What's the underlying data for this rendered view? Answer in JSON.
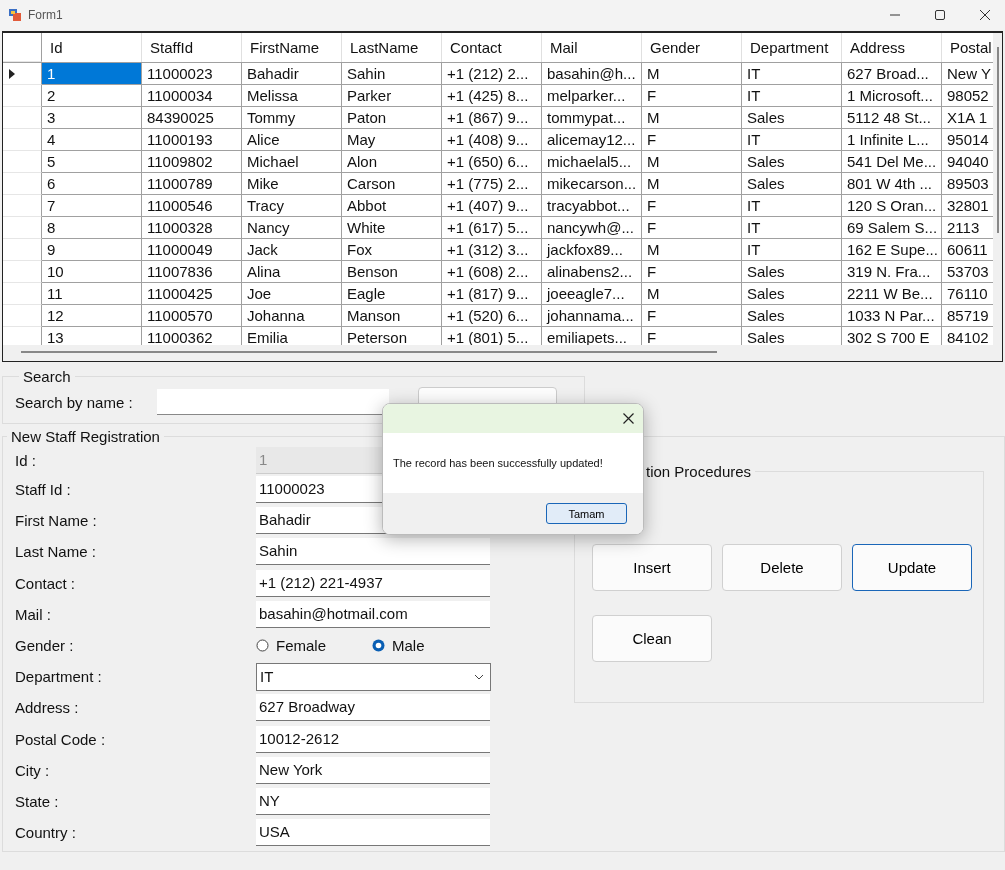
{
  "window": {
    "title": "Form1"
  },
  "grid": {
    "columns": [
      "Id",
      "StaffId",
      "FirstName",
      "LastName",
      "Contact",
      "Mail",
      "Gender",
      "Department",
      "Address",
      "Postal"
    ],
    "rows": [
      {
        "selected": true,
        "cells": [
          "1",
          "11000023",
          "Bahadir",
          "Sahin",
          "+1 (212) 2...",
          "basahin@h...",
          "M",
          "IT",
          "627 Broad...",
          "New Y"
        ]
      },
      {
        "selected": false,
        "cells": [
          "2",
          "11000034",
          "Melissa",
          "Parker",
          "+1 (425) 8...",
          "melparker...",
          "F",
          "IT",
          "1 Microsoft...",
          "98052"
        ]
      },
      {
        "selected": false,
        "cells": [
          "3",
          "84390025",
          "Tommy",
          "Paton",
          "+1 (867) 9...",
          "tommypat...",
          "M",
          "Sales",
          "5112 48 St...",
          "X1A 1"
        ]
      },
      {
        "selected": false,
        "cells": [
          "4",
          "11000193",
          "Alice",
          "May",
          "+1 (408) 9...",
          "alicemay12...",
          "F",
          "IT",
          "1 Infinite L...",
          "95014"
        ]
      },
      {
        "selected": false,
        "cells": [
          "5",
          "11009802",
          "Michael",
          "Alon",
          "+1 (650) 6...",
          "michaelal5...",
          "M",
          "Sales",
          "541 Del Me...",
          "94040"
        ]
      },
      {
        "selected": false,
        "cells": [
          "6",
          "11000789",
          "Mike",
          "Carson",
          "+1 (775) 2...",
          "mikecarson...",
          "M",
          "Sales",
          "801 W 4th ...",
          "89503"
        ]
      },
      {
        "selected": false,
        "cells": [
          "7",
          "11000546",
          "Tracy",
          "Abbot",
          "+1 (407) 9...",
          "tracyabbot...",
          "F",
          "IT",
          "120 S Oran...",
          "32801"
        ]
      },
      {
        "selected": false,
        "cells": [
          "8",
          "11000328",
          "Nancy",
          "White",
          "+1 (617) 5...",
          "nancywh@...",
          "F",
          "IT",
          "69 Salem S...",
          "2113"
        ]
      },
      {
        "selected": false,
        "cells": [
          "9",
          "11000049",
          "Jack",
          "Fox",
          "+1 (312) 3...",
          "jackfox89...",
          "M",
          "IT",
          "162 E Supe...",
          "60611"
        ]
      },
      {
        "selected": false,
        "cells": [
          "10",
          "11007836",
          "Alina",
          "Benson",
          "+1 (608) 2...",
          "alinabens2...",
          "F",
          "Sales",
          "319 N. Fra...",
          "53703"
        ]
      },
      {
        "selected": false,
        "cells": [
          "11",
          "11000425",
          "Joe",
          "Eagle",
          "+1 (817) 9...",
          "joeeagle7...",
          "M",
          "Sales",
          "2211 W Be...",
          "76110"
        ]
      },
      {
        "selected": false,
        "cells": [
          "12",
          "11000570",
          "Johanna",
          "Manson",
          "+1 (520) 6...",
          "johannama...",
          "F",
          "Sales",
          "1033 N Par...",
          "85719"
        ]
      },
      {
        "selected": false,
        "cells": [
          "13",
          "11000362",
          "Emilia",
          "Peterson",
          "+1 (801) 5...",
          "emiliapets...",
          "F",
          "Sales",
          "302 S 700 E",
          "84102"
        ]
      }
    ]
  },
  "search": {
    "title": "Search",
    "label": "Search by name :"
  },
  "registration": {
    "title": "New Staff Registration",
    "fields": [
      {
        "kind": "text",
        "label": "Id :",
        "value": "1",
        "disabled": true
      },
      {
        "kind": "text",
        "label": "Staff Id :",
        "value": "11000023",
        "disabled": false
      },
      {
        "kind": "text",
        "label": "First Name :",
        "value": "Bahadir",
        "disabled": false
      },
      {
        "kind": "text",
        "label": "Last Name :",
        "value": "Sahin",
        "disabled": false
      },
      {
        "kind": "text",
        "label": "Contact :",
        "value": "+1 (212) 221-4937",
        "disabled": false
      },
      {
        "kind": "text",
        "label": "Mail :",
        "value": "basahin@hotmail.com",
        "disabled": false
      },
      {
        "kind": "radio",
        "label": "Gender :",
        "options": [
          {
            "label": "Female",
            "selected": false
          },
          {
            "label": "Male",
            "selected": true
          }
        ]
      },
      {
        "kind": "select",
        "label": "Department :",
        "value": "IT"
      },
      {
        "kind": "text",
        "label": "Address :",
        "value": "627 Broadway",
        "disabled": false
      },
      {
        "kind": "text",
        "label": "Postal Code :",
        "value": "10012-2612",
        "disabled": false
      },
      {
        "kind": "text",
        "label": "City :",
        "value": "New York",
        "disabled": false
      },
      {
        "kind": "text",
        "label": "State :",
        "value": "NY",
        "disabled": false
      },
      {
        "kind": "text",
        "label": "Country :",
        "value": "USA",
        "disabled": false
      }
    ]
  },
  "procedures": {
    "title": "tion Procedures",
    "buttons": [
      {
        "label": "Insert",
        "focused": false
      },
      {
        "label": "Delete",
        "focused": false
      },
      {
        "label": "Update",
        "focused": true
      },
      {
        "label": "Clean",
        "focused": false
      }
    ]
  },
  "dialog": {
    "message": "The record has been successfully updated!",
    "button": "Tamam"
  }
}
